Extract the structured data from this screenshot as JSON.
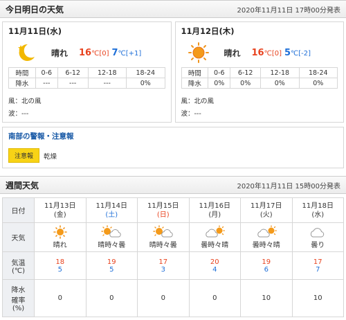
{
  "today_section": {
    "title": "今日明日の天気",
    "issued": "2020年11月11日 17時00分発表"
  },
  "days": [
    {
      "date": "11月11日(水)",
      "icon": "moon-icon",
      "weather": "晴れ",
      "high": "16",
      "high_unit": "℃",
      "high_diff": "[0]",
      "low": "7",
      "low_unit": "℃",
      "low_diff": "[+1]",
      "precip_headers": [
        "時間",
        "0-6",
        "6-12",
        "12-18",
        "18-24"
      ],
      "precip_values": [
        "降水",
        "---",
        "---",
        "---",
        "0%"
      ],
      "wind": "風：北の風",
      "wave": "波：---"
    },
    {
      "date": "11月12日(木)",
      "icon": "sun-icon",
      "weather": "晴れ",
      "high": "16",
      "high_unit": "℃",
      "high_diff": "[0]",
      "low": "5",
      "low_unit": "℃",
      "low_diff": "[-2]",
      "precip_headers": [
        "時間",
        "0-6",
        "6-12",
        "12-18",
        "18-24"
      ],
      "precip_values": [
        "降水",
        "0%",
        "0%",
        "0%",
        "0%"
      ],
      "wind": "風：北の風",
      "wave": "波：---"
    }
  ],
  "warnings": {
    "title": "南部の警報・注意報",
    "badge": "注意報",
    "text": "乾燥"
  },
  "weekly_section": {
    "title": "週間天気",
    "issued": "2020年11月11日 15時00分発表"
  },
  "weekly": {
    "row_labels": {
      "date": "日付",
      "weather": "天気",
      "temp_l1": "気温",
      "temp_l2": "(℃)",
      "rain_l1": "降水",
      "rain_l2": "確率",
      "rain_l3": "(%)"
    },
    "days": [
      {
        "date": "11月13日",
        "dow": "(金)",
        "icon": "sun-icon",
        "weather": "晴れ",
        "high": "18",
        "low": "5",
        "rain": "0"
      },
      {
        "date": "11月14日",
        "dow": "(土)",
        "icon": "sun-cloud-icon",
        "weather": "晴時々曇",
        "high": "19",
        "low": "5",
        "rain": "0"
      },
      {
        "date": "11月15日",
        "dow": "(日)",
        "icon": "sun-cloud-icon",
        "weather": "晴時々曇",
        "high": "17",
        "low": "3",
        "rain": "0"
      },
      {
        "date": "11月16日",
        "dow": "(月)",
        "icon": "cloud-sun-icon",
        "weather": "曇時々晴",
        "high": "20",
        "low": "4",
        "rain": "0"
      },
      {
        "date": "11月17日",
        "dow": "(火)",
        "icon": "cloud-sun-icon",
        "weather": "曇時々晴",
        "high": "19",
        "low": "6",
        "rain": "10"
      },
      {
        "date": "11月18日",
        "dow": "(水)",
        "icon": "cloud-icon",
        "weather": "曇り",
        "high": "17",
        "low": "7",
        "rain": "10"
      }
    ]
  },
  "colors": {
    "high_temp": "#e8431f",
    "low_temp": "#1e6fd8",
    "warning_badge": "#f8d316",
    "row_header_bg": "#eef0f3"
  }
}
